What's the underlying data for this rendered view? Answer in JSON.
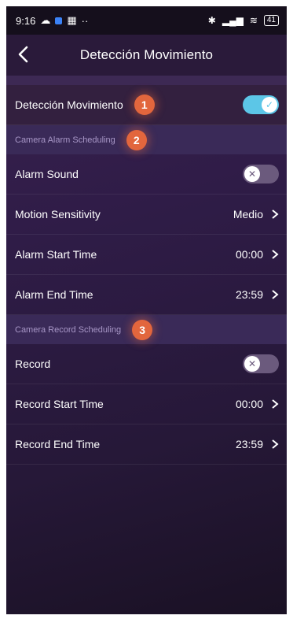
{
  "status_bar": {
    "time": "9:16",
    "battery": "41"
  },
  "app_bar": {
    "title": "Detección Movimiento"
  },
  "motion_detection": {
    "label": "Detección Movimiento",
    "badge": "1",
    "enabled": true
  },
  "alarm_section": {
    "title": "Camera Alarm Scheduling",
    "badge": "2"
  },
  "alarm_sound": {
    "label": "Alarm Sound",
    "enabled": false
  },
  "motion_sensitivity": {
    "label": "Motion Sensitivity",
    "value": "Medio"
  },
  "alarm_start": {
    "label": "Alarm Start Time",
    "value": "00:00"
  },
  "alarm_end": {
    "label": "Alarm End Time",
    "value": "23:59"
  },
  "record_section": {
    "title": "Camera Record Scheduling",
    "badge": "3"
  },
  "record": {
    "label": "Record",
    "enabled": false
  },
  "record_start": {
    "label": "Record Start Time",
    "value": "00:00"
  },
  "record_end": {
    "label": "Record End Time",
    "value": "23:59"
  },
  "colors": {
    "accent_toggle": "#5cc6e7",
    "badge": "#e2663d"
  }
}
